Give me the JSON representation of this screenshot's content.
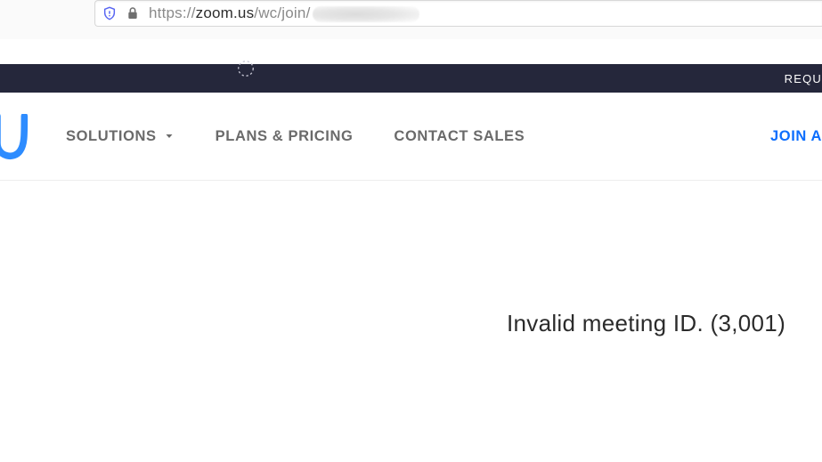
{
  "browser": {
    "url_scheme": "https://",
    "url_host": "zoom.us",
    "url_path": "/wc/join/"
  },
  "top_bar": {
    "request": "REQU"
  },
  "nav": {
    "solutions": "SOLUTIONS",
    "plans": "PLANS & PRICING",
    "contact": "CONTACT SALES"
  },
  "right_nav": {
    "join": "JOIN A"
  },
  "content": {
    "error": "Invalid meeting ID. (3,001)"
  }
}
